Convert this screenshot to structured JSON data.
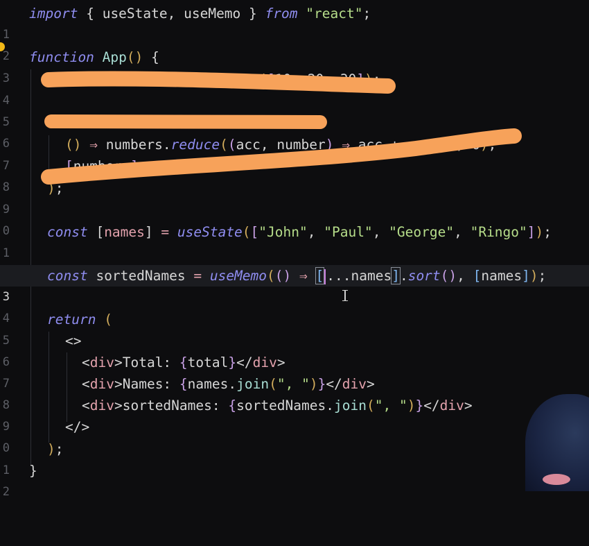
{
  "editor": {
    "lines": [
      {
        "n": "1",
        "text": "import { useState, useMemo } from \"react\";"
      },
      {
        "n": "2",
        "text": ""
      },
      {
        "n": "3",
        "text": "function App() {"
      },
      {
        "n": "4",
        "text": "const [numbers] = useState([10, 20, 30]);"
      },
      {
        "n": "5",
        "text": ""
      },
      {
        "n": "6",
        "text": ""
      },
      {
        "n": "7",
        "text": "() ⇒ numbers.reduce((acc, number) ⇒ acc + number, 0),"
      },
      {
        "n": "8",
        "text": "[numbers]"
      },
      {
        "n": "9",
        "text": ");"
      },
      {
        "n": "0",
        "text": ""
      },
      {
        "n": "1",
        "text": "const [names] = useState([\"John\", \"Paul\", \"George\", \"Ringo\"]);"
      },
      {
        "n": "2",
        "text": ""
      },
      {
        "n": "3",
        "text": "const sortedNames = useMemo(() ⇒ [...names].sort(), [names]);"
      },
      {
        "n": "4",
        "text": ""
      },
      {
        "n": "5",
        "text": "return ("
      },
      {
        "n": "6",
        "text": "<>"
      },
      {
        "n": "7",
        "text": "<div>Total: {total}</div>"
      },
      {
        "n": "8",
        "text": "<div>Names: {names.join(\", \")}</div>"
      },
      {
        "n": "9",
        "text": "<div>sortedNames: {sortedNames.join(\", \")}</div>"
      },
      {
        "n": "0",
        "text": "</>"
      },
      {
        "n": "1",
        "text": ");"
      },
      {
        "n": "2",
        "text": "}"
      }
    ],
    "active_line_index": 12,
    "colors": {
      "background": "#0d0d0f",
      "keyword": "#8f8df0",
      "string": "#b6dd8a",
      "variable": "#e3a2ad",
      "function": "#a9ded4",
      "redaction": "#f7a25a",
      "breakpoint": "#f2b817"
    },
    "icons": {
      "breakpoint": "breakpoint-dot-icon",
      "mouse": "text-cursor-icon"
    }
  }
}
